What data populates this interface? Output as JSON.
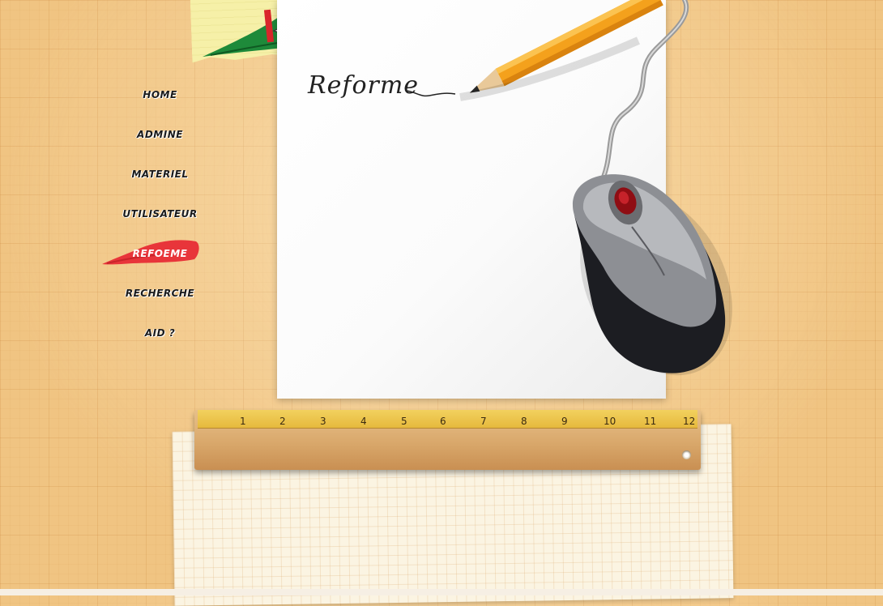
{
  "nav": {
    "items": [
      {
        "label": "HOME"
      },
      {
        "label": "ADMINE"
      },
      {
        "label": "MATERIEL"
      },
      {
        "label": "UTILISATEUR"
      },
      {
        "label": "REFOEME"
      },
      {
        "label": "RECHERCHE"
      },
      {
        "label": "AID ?"
      }
    ],
    "active_index": 4,
    "active_color": "#e8353a"
  },
  "page": {
    "title": "Reforme"
  },
  "ruler": {
    "numbers": [
      "1",
      "2",
      "3",
      "4",
      "5",
      "6",
      "7",
      "8",
      "9",
      "10",
      "11",
      "12"
    ]
  },
  "icons": [
    "logo-icon",
    "pencil-icon",
    "computer-mouse-icon",
    "ruler-icon",
    "brush-highlight-icon"
  ],
  "colors": {
    "background": "#f2c98a",
    "accent": "#e8353a",
    "logo_green": "#1e8a3a",
    "logo_red": "#d9262b"
  }
}
